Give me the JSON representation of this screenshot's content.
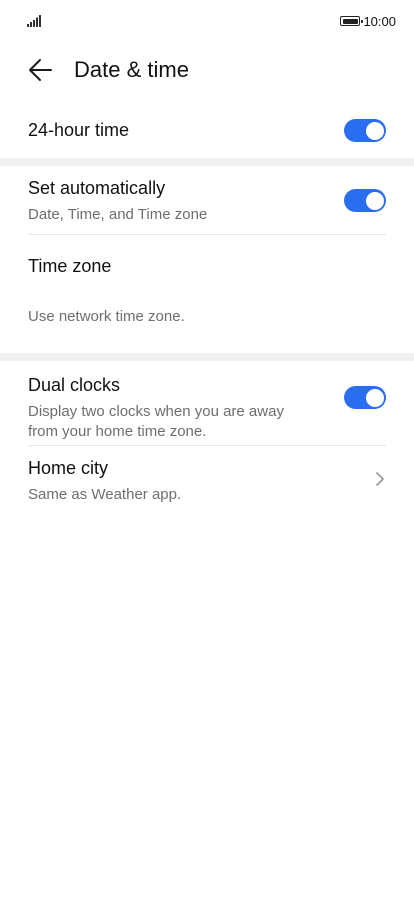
{
  "status": {
    "time": "10:00"
  },
  "header": {
    "title": "Date & time"
  },
  "items": {
    "hour24": {
      "label": "24-hour time",
      "enabled": true
    },
    "set_auto": {
      "label": "Set automatically",
      "subtitle": "Date, Time, and Time zone",
      "enabled": true
    },
    "time_zone": {
      "label": "Time zone"
    },
    "network_tz": {
      "label": "Use network time zone."
    },
    "dual_clocks": {
      "label": "Dual clocks",
      "subtitle": "Display two clocks when you are away from your home time zone.",
      "enabled": true
    },
    "home_city": {
      "label": "Home city",
      "subtitle": "Same as Weather app."
    }
  },
  "colors": {
    "accent": "#2a6ef0",
    "divider": "#e6e6e6",
    "section_gap": "#f1f1f1"
  },
  "icons": {
    "back": "arrow-left-icon",
    "chevron": "chevron-right-icon",
    "signal": "signal-icon",
    "battery": "battery-icon"
  }
}
